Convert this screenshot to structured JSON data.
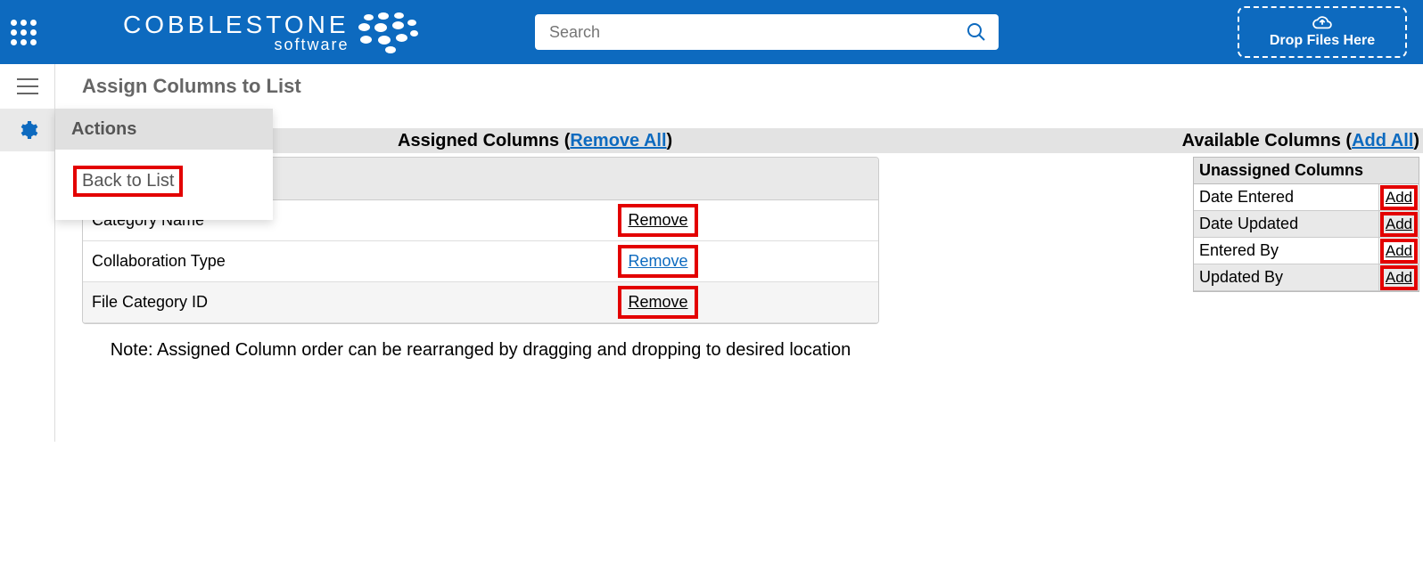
{
  "header": {
    "brand_main": "COBBLESTONE",
    "brand_sub": "software",
    "search_placeholder": "Search",
    "drop_label": "Drop Files Here"
  },
  "page": {
    "title": "Assign Columns to List",
    "actions_label": "Actions",
    "back_to_list": "Back to List",
    "note": "Note: Assigned Column order can be rearranged by dragging and dropping to desired location"
  },
  "assigned": {
    "header_pre": "Assigned Columns (",
    "remove_all": "Remove All",
    "header_post": ")",
    "remove_label": "Remove",
    "columns": [
      {
        "name": "Category Name",
        "link_style": "black"
      },
      {
        "name": "Collaboration Type",
        "link_style": "blue"
      },
      {
        "name": "File Category ID",
        "link_style": "black"
      }
    ]
  },
  "available": {
    "header_pre": "Available Columns (",
    "add_all": "Add All",
    "header_post": ")",
    "table_header": "Unassigned Columns",
    "add_label": "Add",
    "columns": [
      {
        "name": "Date Entered"
      },
      {
        "name": "Date Updated"
      },
      {
        "name": "Entered By"
      },
      {
        "name": "Updated By"
      }
    ]
  }
}
